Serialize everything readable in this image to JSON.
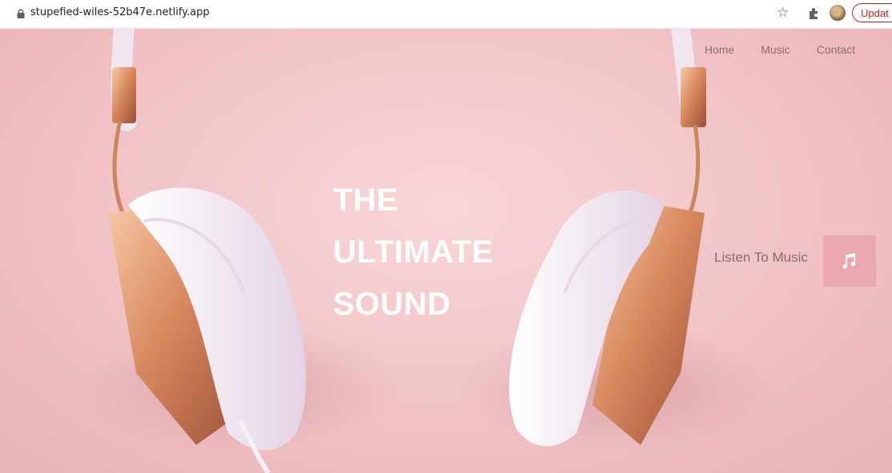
{
  "browser": {
    "url": "stupefied-wiles-52b47e.netlify.app",
    "update_label": "Updat"
  },
  "nav": {
    "items": [
      {
        "label": "Home"
      },
      {
        "label": "Music"
      },
      {
        "label": "Contact"
      }
    ]
  },
  "hero": {
    "headline": [
      "THE",
      "ULTIMATE",
      "SOUND"
    ],
    "listen_label": "Listen To Music",
    "listen_icon": "music-note-icon"
  },
  "colors": {
    "background": "#f3c6c9",
    "accent": "#e9a8b0",
    "update": "#c5221f"
  }
}
